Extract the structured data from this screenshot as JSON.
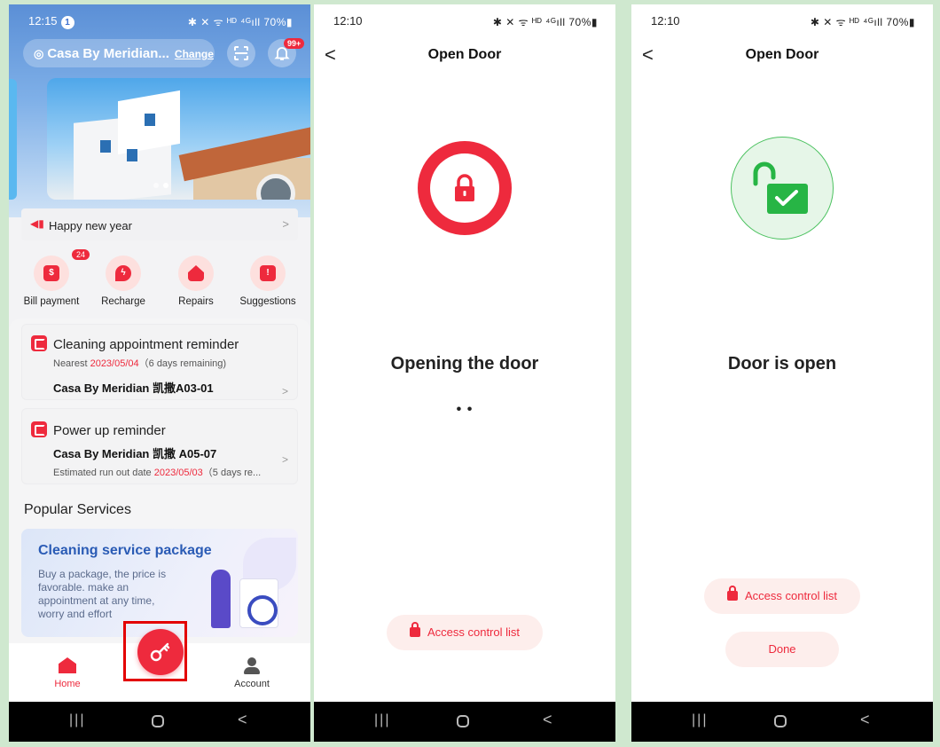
{
  "screen1": {
    "status": {
      "time": "12:15",
      "notif_count": "1",
      "icons": "✱ ✕ ᯤ ᴴᴰ ⁴ᴳıll 70%▮"
    },
    "header": {
      "location": "Casa By Meridian...",
      "change": "Change",
      "badge": "99+"
    },
    "notice": {
      "text": "Happy new year"
    },
    "quick_actions": [
      {
        "label": "Bill payment",
        "count": "24"
      },
      {
        "label": "Recharge"
      },
      {
        "label": "Repairs"
      },
      {
        "label": "Suggestions"
      }
    ],
    "reminder1": {
      "title": "Cleaning appointment reminder",
      "sub_prefix": "Nearest ",
      "date": "2023/05/04",
      "sub_suffix": "（6 days remaining)",
      "unit": "Casa By Meridian 凯撒A03-01"
    },
    "reminder2": {
      "title": "Power up reminder",
      "unit": "Casa By Meridian 凯撒 A05-07",
      "sub_prefix": "Estimated run out date ",
      "date": "2023/05/03",
      "sub_suffix": "（5 days re..."
    },
    "popular": {
      "title": "Popular Services",
      "promo_title": "Cleaning service package",
      "promo_text": "Buy a package, the price is favorable. make an appointment at any time, worry and effort"
    },
    "tabs": {
      "home": "Home",
      "account": "Account"
    }
  },
  "screen2": {
    "status": {
      "time": "12:10",
      "icons": "✱ ✕ ᯤ ᴴᴰ ⁴ᴳıll 70%▮"
    },
    "title": "Open Door",
    "message": "Opening the door",
    "dots": "• •",
    "button": "Access control list"
  },
  "screen3": {
    "status": {
      "time": "12:10",
      "icons": "✱ ✕ ᯤ ᴴᴰ ⁴ᴳıll 70%▮"
    },
    "title": "Open Door",
    "message": "Door is open",
    "button": "Access control list",
    "done": "Done"
  },
  "colors": {
    "accent": "#ee2a3d",
    "success": "#27b545",
    "header_blue": "#5b8fd6"
  },
  "icons": [
    "location-pin-icon",
    "scan-icon",
    "bell-icon",
    "megaphone-icon",
    "chevron-right-icon",
    "key-icon",
    "home-icon",
    "account-icon",
    "lock-icon",
    "unlock-check-icon",
    "back-arrow-icon"
  ]
}
